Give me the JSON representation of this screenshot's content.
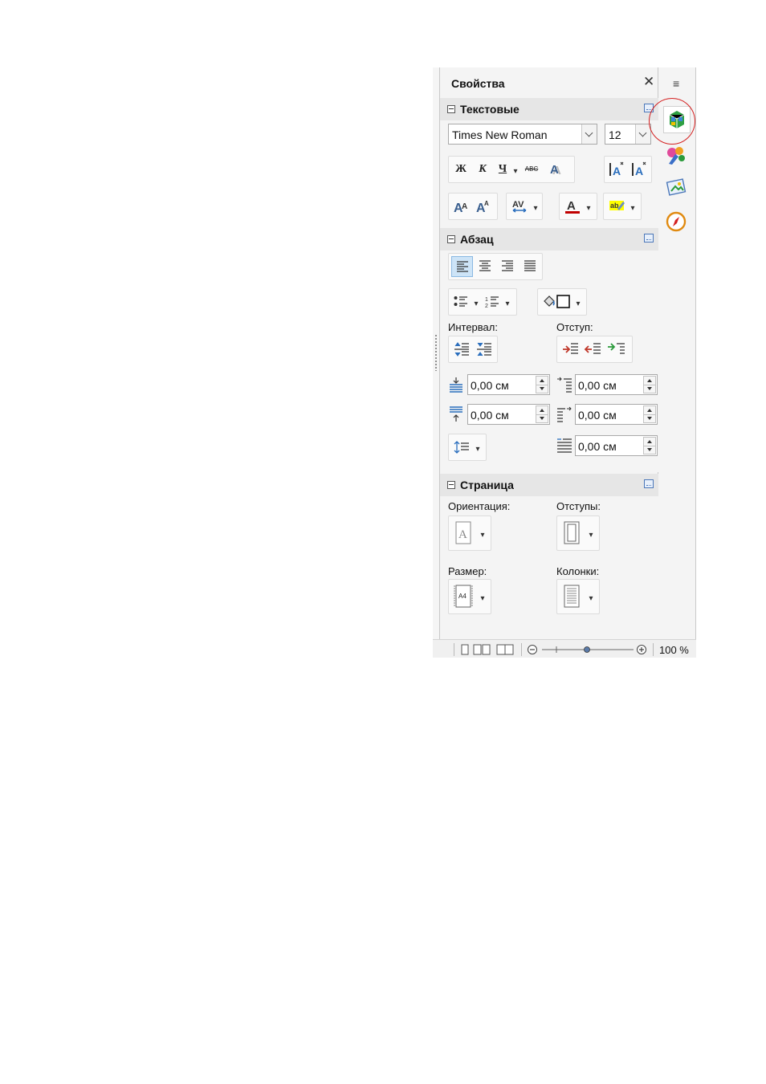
{
  "panel": {
    "title": "Свойства",
    "close_glyph": "✕",
    "menu_glyph": "≡"
  },
  "character": {
    "title": "Текстовые",
    "font_name": "Times New Roman",
    "font_size": "12",
    "bold": "Ж",
    "italic": "К",
    "underline": "Ч",
    "strikethrough": "ABC"
  },
  "paragraph": {
    "title": "Абзац",
    "spacing_label": "Интервал:",
    "indent_label": "Отступ:",
    "above_spacing": "0,00 см",
    "below_spacing": "0,00 см",
    "before_indent": "0,00 см",
    "after_indent": "0,00 см",
    "first_line_indent": "0,00 см"
  },
  "page": {
    "title": "Страница",
    "orientation_label": "Ориентация:",
    "margins_label": "Отступы:",
    "size_label": "Размер:",
    "columns_label": "Колонки:",
    "size_glyph": "A4"
  },
  "status": {
    "zoom": "100 %"
  },
  "colors": {
    "font_color": "#c00000",
    "highlight_color": "#ffff00",
    "accent": "#2a6ebd",
    "ring": "#d42020"
  }
}
